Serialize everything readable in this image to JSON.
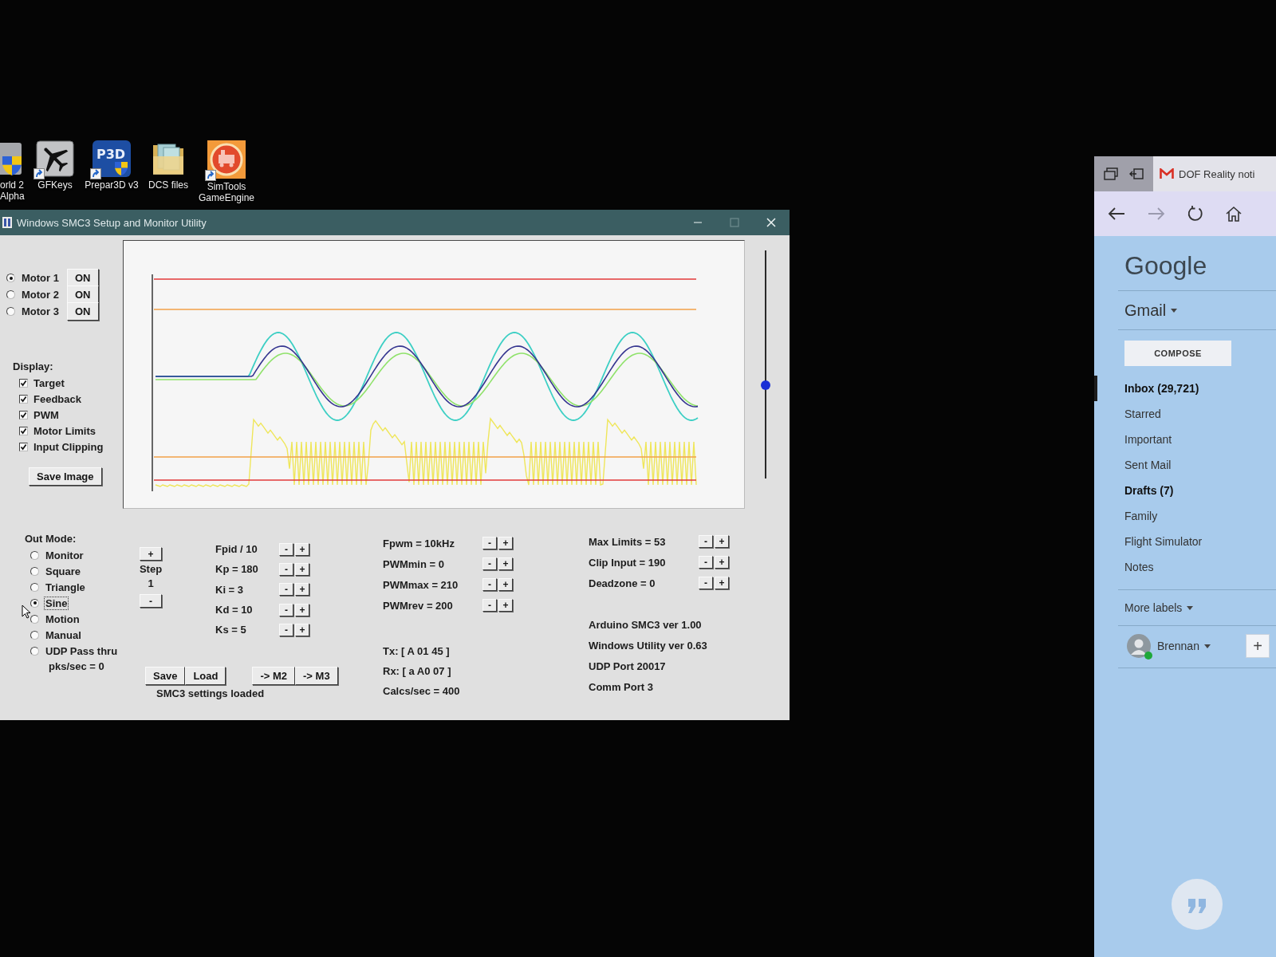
{
  "desktop": {
    "icons": [
      {
        "kind": "shield",
        "label": "orld 2 Alpha",
        "shortcut": false
      },
      {
        "kind": "plane",
        "label": "GFKeys",
        "shortcut": true
      },
      {
        "kind": "p3d",
        "label": "Prepar3D v3",
        "logo_text": "P3D",
        "shortcut": true
      },
      {
        "kind": "folder",
        "label": "DCS files",
        "shortcut": false
      },
      {
        "kind": "emblem",
        "label": "SimTools GameEngine",
        "shortcut": true
      }
    ]
  },
  "window": {
    "title": "Windows SMC3 Setup and Monitor Utility",
    "motors": [
      {
        "label": "Motor 1",
        "selected": true,
        "button": "ON"
      },
      {
        "label": "Motor 2",
        "selected": false,
        "button": "ON"
      },
      {
        "label": "Motor 3",
        "selected": false,
        "button": "ON"
      }
    ],
    "display": {
      "heading": "Display:",
      "options": [
        {
          "label": "Target",
          "checked": true
        },
        {
          "label": "Feedback",
          "checked": true
        },
        {
          "label": "PWM",
          "checked": true
        },
        {
          "label": "Motor Limits",
          "checked": true
        },
        {
          "label": "Input Clipping",
          "checked": true
        }
      ]
    },
    "save_image": "Save Image",
    "position_slider": {
      "level": 0.41
    },
    "out_mode": {
      "heading": "Out Mode:",
      "options": [
        {
          "label": "Monitor",
          "selected": false,
          "focused": false
        },
        {
          "label": "Square",
          "selected": false,
          "focused": false
        },
        {
          "label": "Triangle",
          "selected": false,
          "focused": false
        },
        {
          "label": "Sine",
          "selected": true,
          "focused": true
        },
        {
          "label": "Motion",
          "selected": false,
          "focused": false
        },
        {
          "label": "Manual",
          "selected": false,
          "focused": false
        },
        {
          "label": "UDP Pass thru",
          "selected": false,
          "focused": false
        }
      ],
      "packets": "pks/sec = 0"
    },
    "step": {
      "increase": "+",
      "label": "Step",
      "value": "1",
      "decrease": "-"
    },
    "pid_params": [
      {
        "label": "Fpid / 10",
        "buttons": [
          "-",
          "+"
        ]
      },
      {
        "label": "Kp = 180",
        "buttons": [
          "-",
          "+"
        ]
      },
      {
        "label": "Ki = 3",
        "buttons": [
          "-",
          "+"
        ]
      },
      {
        "label": "Kd = 10",
        "buttons": [
          "-",
          "+"
        ]
      },
      {
        "label": "Ks = 5",
        "buttons": [
          "-",
          "+"
        ]
      }
    ],
    "pwm_params": [
      {
        "label": "Fpwm = 10kHz",
        "buttons": [
          "-",
          "+"
        ]
      },
      {
        "label": "PWMmin = 0",
        "buttons": [
          "-",
          "+"
        ]
      },
      {
        "label": "PWMmax = 210",
        "buttons": [
          "-",
          "+"
        ]
      },
      {
        "label": "PWMrev = 200",
        "buttons": [
          "-",
          "+"
        ]
      }
    ],
    "limit_params": [
      {
        "label": "Max Limits = 53",
        "buttons": [
          "-",
          "+"
        ]
      },
      {
        "label": "Clip Input = 190",
        "buttons": [
          "-",
          "+"
        ]
      },
      {
        "label": "Deadzone = 0",
        "buttons": [
          "-",
          "+"
        ]
      }
    ],
    "file_buttons": [
      "Save",
      "Load"
    ],
    "copy_buttons": [
      "-> M2",
      "-> M3"
    ],
    "status": "SMC3 settings loaded",
    "readouts": [
      "Tx: [ A 01 45 ]",
      "Rx: [ a A0 07 ]",
      "Calcs/sec = 400"
    ],
    "info": [
      "Arduino SMC3 ver 1.00",
      "Windows Utility ver 0.63",
      "UDP Port 20017",
      "Comm Port 3"
    ]
  },
  "browser": {
    "tab_title": "DOF Reality noti",
    "forward_disabled": true,
    "logo": "Google",
    "app_menu": "Gmail",
    "compose": "COMPOSE",
    "labels": [
      {
        "label": "Inbox (29,721)",
        "selected": true,
        "unread": true
      },
      {
        "label": "Starred",
        "selected": false,
        "unread": false
      },
      {
        "label": "Important",
        "selected": false,
        "unread": false
      },
      {
        "label": "Sent Mail",
        "selected": false,
        "unread": false
      },
      {
        "label": "Drafts (7)",
        "selected": false,
        "unread": true
      },
      {
        "label": "Family",
        "selected": false,
        "unread": false
      },
      {
        "label": "Flight Simulator",
        "selected": false,
        "unread": false
      },
      {
        "label": "Notes",
        "selected": false,
        "unread": false
      }
    ],
    "more_labels": "More labels",
    "account": {
      "name": "Brennan",
      "online": true
    },
    "add_button": "+"
  }
}
